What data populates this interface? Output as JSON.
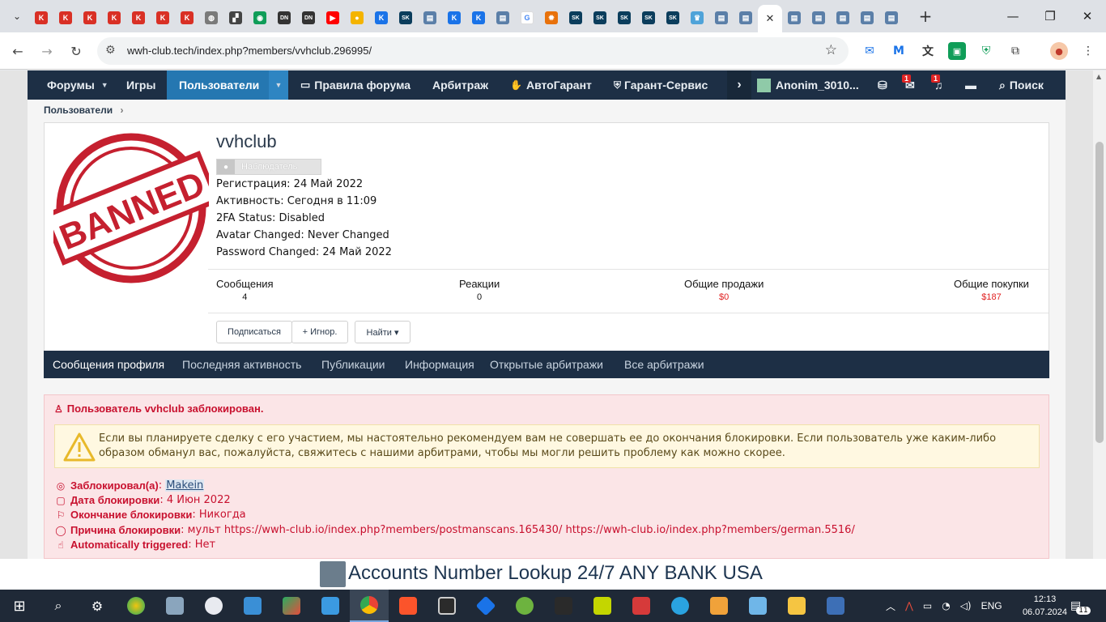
{
  "browser": {
    "tabs": [
      {
        "icon": "k-icon",
        "color": "#d93025",
        "glyph": "K"
      },
      {
        "icon": "k-icon",
        "color": "#d93025",
        "glyph": "K"
      },
      {
        "icon": "k-icon",
        "color": "#d93025",
        "glyph": "K"
      },
      {
        "icon": "k-icon",
        "color": "#d93025",
        "glyph": "K"
      },
      {
        "icon": "k-icon",
        "color": "#d93025",
        "glyph": "K"
      },
      {
        "icon": "k-icon",
        "color": "#d93025",
        "glyph": "K"
      },
      {
        "icon": "k-icon",
        "color": "#d93025",
        "glyph": "K"
      },
      {
        "icon": "globe-icon",
        "color": "#7a7a7a",
        "glyph": "◍"
      },
      {
        "icon": "site-icon",
        "color": "#444",
        "glyph": "▞"
      },
      {
        "icon": "site-icon",
        "color": "#0f9d58",
        "glyph": "◉"
      },
      {
        "icon": "dn-icon",
        "color": "#333",
        "glyph": "DN"
      },
      {
        "icon": "dn-icon",
        "color": "#333",
        "glyph": "DN"
      },
      {
        "icon": "youtube-icon",
        "color": "#ff0000",
        "glyph": "▶"
      },
      {
        "icon": "site-icon",
        "color": "#f4b400",
        "glyph": "●"
      },
      {
        "icon": "k-icon",
        "color": "#1a73e8",
        "glyph": "K"
      },
      {
        "icon": "sk-icon",
        "color": "#0b3d5c",
        "glyph": "SK"
      },
      {
        "icon": "site-icon",
        "color": "#5b7fa8",
        "glyph": "▤"
      },
      {
        "icon": "k-icon",
        "color": "#1a73e8",
        "glyph": "K"
      },
      {
        "icon": "k-icon",
        "color": "#1a73e8",
        "glyph": "K"
      },
      {
        "icon": "site-icon",
        "color": "#5b7fa8",
        "glyph": "▤"
      },
      {
        "icon": "google-icon",
        "color": "#ffffff",
        "glyph": "G"
      },
      {
        "icon": "site-icon",
        "color": "#e8710a",
        "glyph": "✹"
      },
      {
        "icon": "sk-icon",
        "color": "#0b3d5c",
        "glyph": "SK"
      },
      {
        "icon": "sk-icon",
        "color": "#0b3d5c",
        "glyph": "SK"
      },
      {
        "icon": "sk-icon",
        "color": "#0b3d5c",
        "glyph": "SK"
      },
      {
        "icon": "sk-icon",
        "color": "#0b3d5c",
        "glyph": "SK"
      },
      {
        "icon": "sk-icon",
        "color": "#0b3d5c",
        "glyph": "SK"
      },
      {
        "icon": "crown-icon",
        "color": "#4fa3d9",
        "glyph": "♛"
      },
      {
        "icon": "site-icon",
        "color": "#5b7fa8",
        "glyph": "▤"
      },
      {
        "icon": "site-icon",
        "color": "#5b7fa8",
        "glyph": "▤"
      }
    ],
    "tabs_after": [
      {
        "icon": "site-icon",
        "color": "#5b7fa8",
        "glyph": "▤"
      },
      {
        "icon": "site-icon",
        "color": "#5b7fa8",
        "glyph": "▤"
      },
      {
        "icon": "site-icon",
        "color": "#5b7fa8",
        "glyph": "▤"
      },
      {
        "icon": "site-icon",
        "color": "#5b7fa8",
        "glyph": "▤"
      },
      {
        "icon": "site-icon",
        "color": "#5b7fa8",
        "glyph": "▤"
      }
    ],
    "url": "wwh-club.tech/index.php?members/vvhclub.296995/"
  },
  "nav": {
    "forums": "Форумы",
    "games": "Игры",
    "users": "Пользователи",
    "rules": "Правила форума",
    "arbitration": "Арбитраж",
    "autoguarantee": "АвтоГарант",
    "guarantee_service": "Гарант-Сервис",
    "account": "Anonim_3010...",
    "conv_badge": "1",
    "alert_badge": "1",
    "search": "Поиск"
  },
  "breadcrumb": {
    "item": "Пользователи"
  },
  "profile": {
    "avatar_stamp": "BANNED",
    "username": "vvhclub",
    "role": "Наблюдатель",
    "info": [
      "Регистрация: 24 Май 2022",
      "Активность: Сегодня в 11:09",
      "2FA Status: Disabled",
      "Avatar Changed: Never Changed",
      "Password Changed: 24 Май 2022"
    ],
    "stats": {
      "messages_label": "Сообщения",
      "messages_value": "4",
      "reactions_label": "Реакции",
      "reactions_value": "0",
      "sales_label": "Общие продажи",
      "sales_value": "$0",
      "purchases_label": "Общие покупки",
      "purchases_value": "$187"
    },
    "buttons": {
      "follow": "Подписаться",
      "ignore": "+ Игнор.",
      "find": "Найти ▾"
    }
  },
  "profile_tabs": [
    "Сообщения профиля",
    "Последняя активность",
    "Публикации",
    "Информация",
    "Открытые арбитражи",
    "Все арбитражи"
  ],
  "ban": {
    "header": "Пользователь vvhclub заблокирован.",
    "warning": "Если вы планируете сделку с его участием, мы настоятельно рекомендуем вам не совершать ее до окончания блокировки. Если пользователь уже каким-либо образом обманул вас, пожалуйста, свяжитесь с нашими арбитрами, чтобы мы могли решить проблему как можно скорее.",
    "banned_by_label": "Заблокировал(а)",
    "banned_by": "Makein",
    "date_label": "Дата блокировки",
    "date": "4 Июн 2022",
    "end_label": "Окончание блокировки",
    "end": "Никогда",
    "reason_label": "Причина блокировки",
    "reason": "мульт https://wwh-club.io/index.php?members/postmanscans.165430/ https://wwh-club.io/index.php?members/german.5516/",
    "auto_label": "Automatically triggered",
    "auto": "Нет"
  },
  "ad": {
    "text": "Accounts Number Lookup 24/7 ANY BANK USA"
  },
  "taskbar": {
    "lang": "ENG",
    "time": "12:13",
    "date": "06.07.2024",
    "notif": "11"
  }
}
